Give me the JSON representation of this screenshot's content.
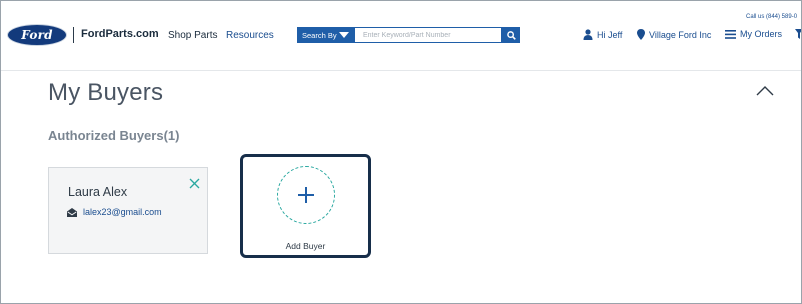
{
  "header": {
    "logo_text": "Ford",
    "site_name": "FordParts.com",
    "nav": {
      "shop_parts": "Shop Parts",
      "resources": "Resources"
    },
    "search": {
      "by_label": "Search By",
      "placeholder": "Enter Keyword/Part Number",
      "value": ""
    },
    "call_us": "Call us (844) 589-0",
    "user_greeting": "Hi Jeff",
    "dealer": "Village Ford Inc",
    "my_orders": "My Orders"
  },
  "main": {
    "page_title": "My Buyers",
    "section_title": "Authorized Buyers(1)",
    "buyers": [
      {
        "name": "Laura Alex",
        "email": "lalex23@gmail.com"
      }
    ],
    "add_buyer_label": "Add Buyer"
  },
  "colors": {
    "brand_blue": "#1f5ea8",
    "ford_navy": "#133a7c",
    "teal_accent": "#2aa8a0",
    "card_border_dark": "#172e4a"
  },
  "icons": [
    "search-icon",
    "user-icon",
    "location-pin-icon",
    "list-icon",
    "filter-icon",
    "chevron-up-icon",
    "close-icon",
    "mail-icon",
    "plus-icon"
  ]
}
